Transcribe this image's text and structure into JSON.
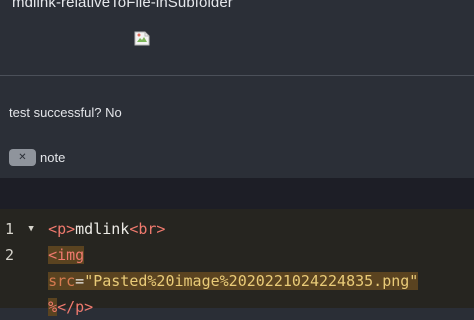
{
  "preview": {
    "title": "mdlink-relativeToFile-inSubfolder",
    "status_text": "test successful? No",
    "tag_chip_symbol": "✕",
    "tag_label": "note"
  },
  "editor": {
    "lines": [
      {
        "number": "1",
        "fold": "▼",
        "open_tag": "<p>",
        "text": "mdlink",
        "br_tag": "<br>"
      },
      {
        "number": "2",
        "img_tag": "<img"
      },
      {
        "attr_name": "src",
        "attr_eq": "=",
        "attr_value": "\"Pasted%20image%2020221024224835.png\""
      },
      {
        "slash": "%",
        "close_tag": "</p>"
      }
    ]
  },
  "colors": {
    "preview_bg": "#2b2f37",
    "editor_bg": "#262520",
    "tag": "#f07a6e",
    "string": "#e9cb78",
    "highlight": "#5a4320"
  }
}
